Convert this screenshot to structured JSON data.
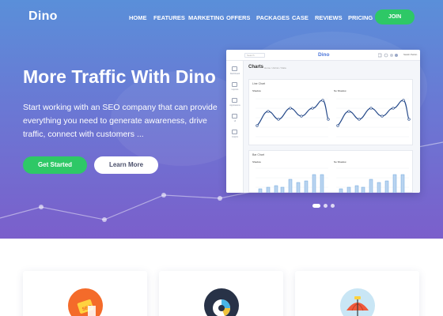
{
  "brand": {
    "logo": "Dino"
  },
  "nav": {
    "items": [
      "HOME",
      "FEATURES",
      "MARKETING",
      "OFFERS",
      "PACKAGES",
      "CASE",
      "REVIEWS",
      "PRICING"
    ],
    "join_label": "JOIN"
  },
  "hero": {
    "title": "More Traffic With Dino",
    "description": "Start working with an SEO company that can provide everything you need to generate awareness, drive traffic, connect with customers ...",
    "primary_button": "Get Started",
    "secondary_button": "Learn More"
  },
  "dashboard": {
    "search_placeholder": "Search",
    "logo": "Dino",
    "user": "Sarah Perkin",
    "page_title": "Charts",
    "breadcrumb": "Home / Admin / Data",
    "sidebar": [
      "Dashboard",
      "Layouts",
      "Applications",
      "UI",
      "Graphs"
    ],
    "line_chart": {
      "title": "Line Chart",
      "left_label": "Shadow",
      "right_label": "No Shadow"
    },
    "bar_chart": {
      "title": "Bar Chart",
      "left_label": "Shadow",
      "right_label": "No Shadow"
    }
  },
  "slider": {
    "count": 3,
    "active": 1
  },
  "colors": {
    "hero_top": "#5a8fd9",
    "hero_bottom": "#7b5fcb",
    "accent_green": "#2ec866",
    "dashboard_blue": "#4a74d9"
  },
  "features": [
    {
      "icon": "seo-tag-icon"
    },
    {
      "icon": "pie-chart-icon"
    },
    {
      "icon": "umbrella-icon"
    }
  ]
}
